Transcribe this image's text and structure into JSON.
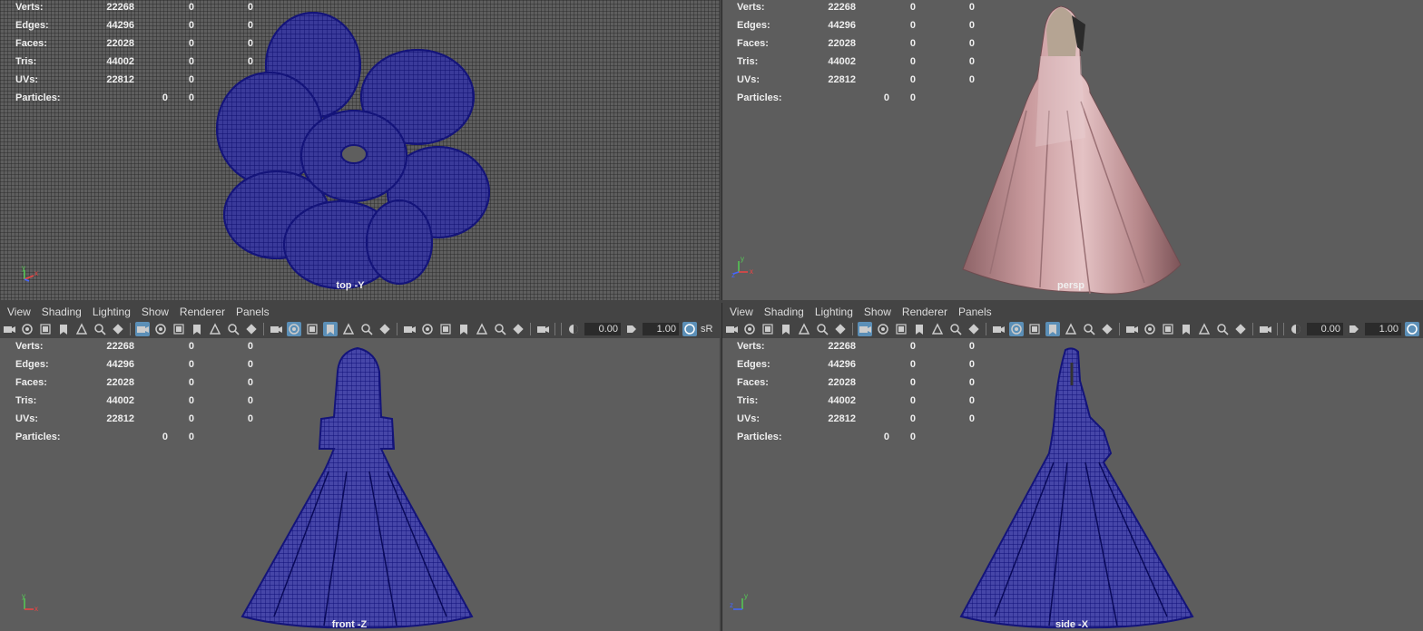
{
  "hud": {
    "labels": [
      "Verts:",
      "Edges:",
      "Faces:",
      "Tris:",
      "UVs:",
      "Particles:"
    ],
    "rows": [
      {
        "label": "Verts:",
        "v1": "22268",
        "v2": "0",
        "v3": "0"
      },
      {
        "label": "Edges:",
        "v1": "44296",
        "v2": "0",
        "v3": "0"
      },
      {
        "label": "Faces:",
        "v1": "22028",
        "v2": "0",
        "v3": "0"
      },
      {
        "label": "Tris:",
        "v1": "44002",
        "v2": "0",
        "v3": "0"
      },
      {
        "label": "UVs:",
        "v1": "22812",
        "v2": "0",
        "v3": "0"
      }
    ],
    "particles": {
      "label": "Particles:",
      "v1": "0",
      "v2": "0"
    }
  },
  "panels": {
    "top_left": {
      "camera": "top -Y"
    },
    "top_right": {
      "camera": "persp"
    },
    "bottom_left": {
      "camera": "front -Z"
    },
    "bottom_right": {
      "camera": "side -X"
    }
  },
  "menu": {
    "items": [
      "View",
      "Shading",
      "Lighting",
      "Show",
      "Renderer",
      "Panels"
    ]
  },
  "toolbar": {
    "exposure": "0.00",
    "gamma": "1.00",
    "srgb_label": "sR",
    "icons": [
      "camera-icon",
      "camera-attr-icon",
      "bookmark-camera-icon",
      "bookmark-icon",
      "image-plane-icon",
      "pan-zoom-icon",
      "grease-pencil-icon",
      "grid-icon",
      "film-gate-icon",
      "resolution-gate-icon",
      "gate-mask-icon",
      "field-chart-icon",
      "safe-action-icon",
      "safe-title-icon",
      "wireframe-icon",
      "smooth-shade-icon",
      "default-material-icon",
      "wireframe-on-shaded-icon",
      "xray-icon",
      "use-all-lights-icon",
      "shadows-icon",
      "ambient-occlusion-icon",
      "motion-blur-icon",
      "anti-alias-icon",
      "depth-of-field-icon",
      "isolate-select-icon",
      "xray-joints-icon",
      "xray-active-icon",
      "backface-icon",
      "exposure-icon",
      "gamma-icon",
      "color-management-icon"
    ]
  },
  "axes": {
    "x": "x",
    "y": "y",
    "z": "z"
  },
  "colors": {
    "viewport_bg": "#5d5d5d",
    "menubar_bg": "#444444",
    "wireframe": "#1a1a8c",
    "dress_pink": "#c99a9d",
    "active_icon": "#5b8fb7"
  }
}
